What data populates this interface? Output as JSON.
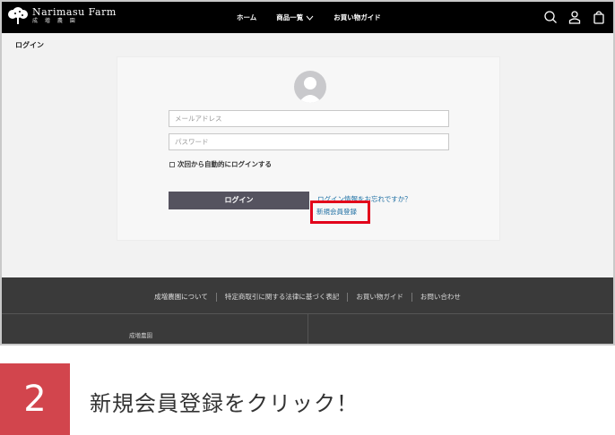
{
  "header": {
    "logo_main": "Narimasu Farm",
    "logo_sub": "成 増 農 園",
    "nav": [
      {
        "label": "ホーム"
      },
      {
        "label": "商品一覧"
      },
      {
        "label": "お買い物ガイド"
      }
    ],
    "icons": [
      "search-icon",
      "user-icon",
      "bag-icon"
    ]
  },
  "page": {
    "heading": "ログイン",
    "email_placeholder": "メールアドレス",
    "password_placeholder": "パスワード",
    "remember_label": "次回から自動的にログインする",
    "login_button": "ログイン",
    "forgot_link": "ログイン情報をお忘れですか？",
    "register_link": "新規会員登録"
  },
  "footer": {
    "links": [
      "成増農園について",
      "特定商取引に関する法律に基づく表記",
      "お買い物ガイド",
      "お問い合わせ"
    ],
    "brand": "成増農園"
  },
  "caption": {
    "step": "2",
    "text": "新規会員登録をクリック！"
  },
  "colors": {
    "header_bg": "#000000",
    "button_bg": "#55535f",
    "link": "#1f6fa3",
    "highlight": "#e2001a",
    "step_bg": "#d2454d",
    "footer_bg": "#3a3a3a"
  }
}
